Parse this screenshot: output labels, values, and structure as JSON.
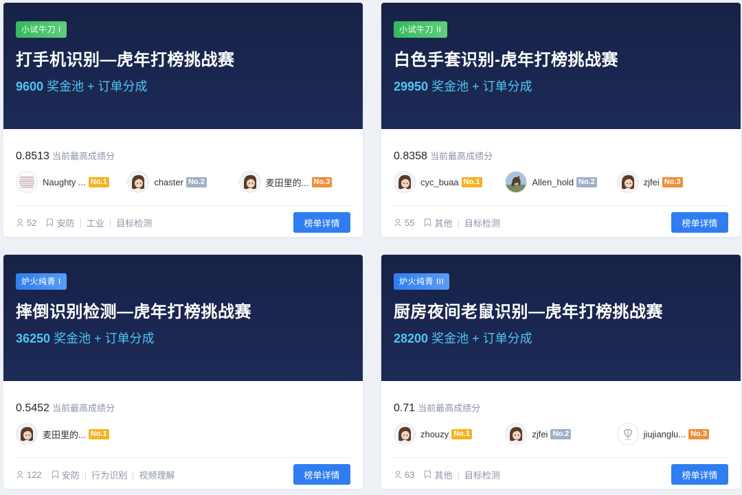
{
  "cards": [
    {
      "tag": "小试牛刀 I",
      "title": "打手机识别—虎年打榜挑战赛",
      "prize_amount": "9600",
      "prize_text": " 奖金池 + 订单分成",
      "score": "0.8513",
      "score_label": "当前最高成绩分",
      "rankers": [
        {
          "name": "Naughty ...",
          "rank": "No.1",
          "avatar": "pattern-avatar"
        },
        {
          "name": "chaster",
          "rank": "No.2",
          "avatar": "cartoon-girl-avatar"
        },
        {
          "name": "麦田里的...",
          "rank": "No.3",
          "avatar": "cartoon-girl-avatar"
        }
      ],
      "participants": "52",
      "tags": [
        "安防",
        "工业",
        "目标检测"
      ],
      "button": "榜单详情"
    },
    {
      "tag": "小试牛刀 II",
      "title": "白色手套识别-虎年打榜挑战赛",
      "prize_amount": "29950",
      "prize_text": " 奖金池 + 订单分成",
      "score": "0.8358",
      "score_label": "当前最高成绩分",
      "rankers": [
        {
          "name": "cyc_buaa",
          "rank": "No.1",
          "avatar": "cartoon-girl-avatar"
        },
        {
          "name": "Allen_hold",
          "rank": "No.2",
          "avatar": "horse-photo-avatar"
        },
        {
          "name": "zjfei",
          "rank": "No.3",
          "avatar": "cartoon-girl-avatar"
        }
      ],
      "participants": "55",
      "tags": [
        "其他",
        "目标检测"
      ],
      "button": "榜单详情"
    },
    {
      "tag": "炉火纯青 I",
      "title": "摔倒识别检测—虎年打榜挑战赛",
      "prize_amount": "36250",
      "prize_text": " 奖金池 + 订单分成",
      "score": "0.5452",
      "score_label": "当前最高成绩分",
      "rankers": [
        {
          "name": "麦田里的...",
          "rank": "No.1",
          "avatar": "cartoon-girl-avatar"
        }
      ],
      "participants": "122",
      "tags": [
        "安防",
        "行为识别",
        "视频理解"
      ],
      "button": "榜单详情"
    },
    {
      "tag": "炉火纯青 III",
      "title": "厨房夜间老鼠识别—虎年打榜挑战赛",
      "prize_amount": "28200",
      "prize_text": " 奖金池 + 订单分成",
      "score": "0.71",
      "score_label": "当前最高成绩分",
      "rankers": [
        {
          "name": "zhouzy",
          "rank": "No.1",
          "avatar": "cartoon-girl-avatar"
        },
        {
          "name": "zjfei",
          "rank": "No.2",
          "avatar": "cartoon-girl-avatar"
        },
        {
          "name": "jiujianglu...",
          "rank": "No.3",
          "avatar": "logo-avatar"
        }
      ],
      "participants": "63",
      "tags": [
        "其他",
        "目标检测"
      ],
      "button": "榜单详情"
    }
  ],
  "colors": {
    "banner": "#172246",
    "prize": "#4fc6f0",
    "button": "#2f7df0",
    "tag_green": "#34b95d",
    "tag_blue": "#2f7df0",
    "rank1": "#f5b323",
    "rank2": "#9fb0c8",
    "rank3": "#ef8e3a"
  }
}
